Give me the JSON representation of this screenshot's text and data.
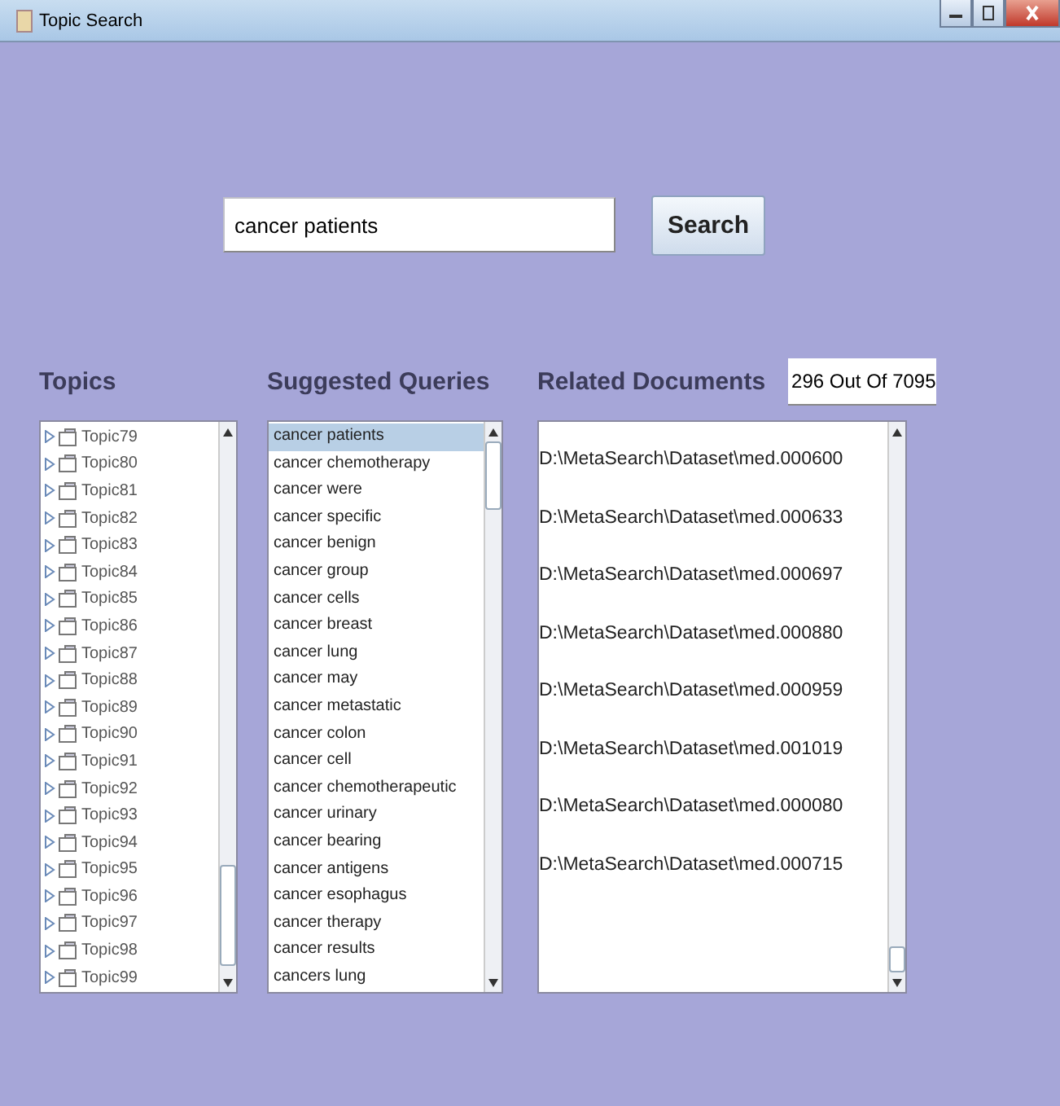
{
  "window": {
    "title": "Topic Search"
  },
  "search": {
    "value": "cancer patients",
    "button": "Search"
  },
  "topics": {
    "heading": "Topics",
    "items": [
      {
        "label": "Topic79",
        "expanded": false
      },
      {
        "label": "Topic80",
        "expanded": false
      },
      {
        "label": "Topic81",
        "expanded": false
      },
      {
        "label": "Topic82",
        "expanded": false
      },
      {
        "label": "Topic83",
        "expanded": false
      },
      {
        "label": "Topic84",
        "expanded": false
      },
      {
        "label": "Topic85",
        "expanded": false
      },
      {
        "label": "Topic86",
        "expanded": false
      },
      {
        "label": "Topic87",
        "expanded": false
      },
      {
        "label": "Topic88",
        "expanded": false
      },
      {
        "label": "Topic89",
        "expanded": false
      },
      {
        "label": "Topic90",
        "expanded": false
      },
      {
        "label": "Topic91",
        "expanded": false
      },
      {
        "label": "Topic92",
        "expanded": false
      },
      {
        "label": "Topic93",
        "expanded": false
      },
      {
        "label": "Topic94",
        "expanded": false
      },
      {
        "label": "Topic95",
        "expanded": false
      },
      {
        "label": "Topic96",
        "expanded": false
      },
      {
        "label": "Topic97",
        "expanded": false
      },
      {
        "label": "Topic98",
        "expanded": false
      },
      {
        "label": "Topic99",
        "expanded": false
      }
    ]
  },
  "queries": {
    "heading": "Suggested Queries",
    "items": [
      {
        "label": "cancer patients",
        "selected": true
      },
      {
        "label": "cancer chemotherapy",
        "selected": false
      },
      {
        "label": "cancer were",
        "selected": false
      },
      {
        "label": "cancer specific",
        "selected": false
      },
      {
        "label": "cancer benign",
        "selected": false
      },
      {
        "label": "cancer group",
        "selected": false
      },
      {
        "label": "cancer cells",
        "selected": false
      },
      {
        "label": "cancer breast",
        "selected": false
      },
      {
        "label": "cancer lung",
        "selected": false
      },
      {
        "label": "cancer may",
        "selected": false
      },
      {
        "label": "cancer metastatic",
        "selected": false
      },
      {
        "label": "cancer colon",
        "selected": false
      },
      {
        "label": "cancer cell",
        "selected": false
      },
      {
        "label": "cancer chemotherapeutic",
        "selected": false
      },
      {
        "label": "cancer urinary",
        "selected": false
      },
      {
        "label": "cancer bearing",
        "selected": false
      },
      {
        "label": "cancer antigens",
        "selected": false
      },
      {
        "label": "cancer esophagus",
        "selected": false
      },
      {
        "label": "cancer therapy",
        "selected": false
      },
      {
        "label": "cancer results",
        "selected": false
      },
      {
        "label": "cancers lung",
        "selected": false
      }
    ]
  },
  "documents": {
    "heading": "Related Documents",
    "count": "296 Out Of 7095",
    "items": [
      "D:\\MetaSearch\\Dataset\\med.000600",
      "D:\\MetaSearch\\Dataset\\med.000633",
      "D:\\MetaSearch\\Dataset\\med.000697",
      "D:\\MetaSearch\\Dataset\\med.000880",
      "D:\\MetaSearch\\Dataset\\med.000959",
      "D:\\MetaSearch\\Dataset\\med.001019",
      "D:\\MetaSearch\\Dataset\\med.000080",
      "D:\\MetaSearch\\Dataset\\med.000715"
    ]
  }
}
